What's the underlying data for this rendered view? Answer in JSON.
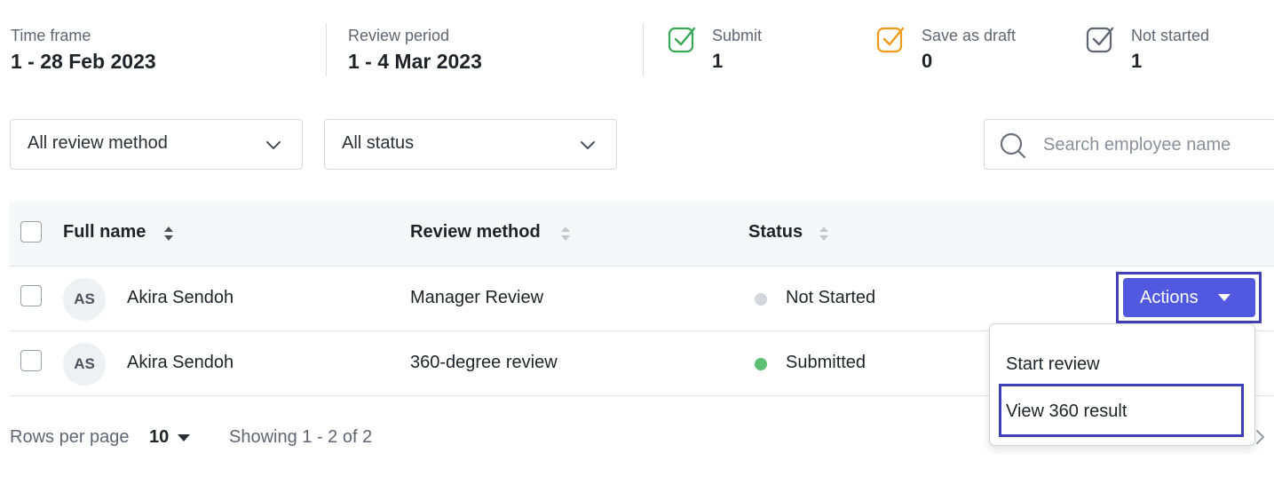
{
  "summary": {
    "time_frame": {
      "label": "Time frame",
      "value": "1 - 28 Feb 2023"
    },
    "review_period": {
      "label": "Review period",
      "value": "1 - 4 Mar 2023"
    },
    "stats": [
      {
        "label": "Submit",
        "value": "1",
        "icon": "check-square-icon",
        "color": "#3aa757"
      },
      {
        "label": "Save as draft",
        "value": "0",
        "icon": "check-square-icon",
        "color": "#f09a1a"
      },
      {
        "label": "Not started",
        "value": "1",
        "icon": "check-square-icon",
        "color": "#5f6672"
      }
    ]
  },
  "filters": {
    "review_method": "All review method",
    "status": "All status",
    "search_placeholder": "Search employee name"
  },
  "table": {
    "columns": [
      "Full name",
      "Review method",
      "Status"
    ],
    "rows": [
      {
        "initials": "AS",
        "name": "Akira Sendoh",
        "method": "Manager Review",
        "status": "Not Started",
        "status_color": "#d3d6dc"
      },
      {
        "initials": "AS",
        "name": "Akira Sendoh",
        "method": "360-degree review",
        "status": "Submitted",
        "status_color": "#5cbf74"
      }
    ]
  },
  "actions": {
    "button_label": "Actions",
    "menu": [
      "Start review",
      "View 360 result"
    ]
  },
  "footer": {
    "rows_per_page_label": "Rows per page",
    "rows_per_page_value": "10",
    "showing": "Showing 1 - 2 of 2"
  },
  "colors": {
    "accent": "#5159e0",
    "highlight": "#3f3fb7"
  }
}
